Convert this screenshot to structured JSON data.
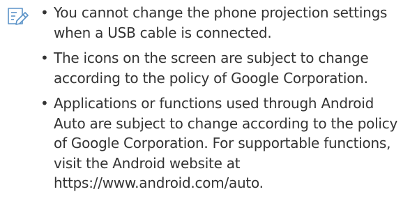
{
  "note": {
    "icon": "note-icon",
    "items": [
      "You cannot change the phone projection settings when a USB cable is connected.",
      "The icons on the screen are subject to change according to the policy of Google Corporation.",
      "Applications or functions used through Android Auto are subject to change according to the policy of Google Corporation. For supportable functions, visit the Android website at https://www.android.com/auto."
    ]
  },
  "colors": {
    "icon": "#5b93c8",
    "text": "#333333"
  }
}
